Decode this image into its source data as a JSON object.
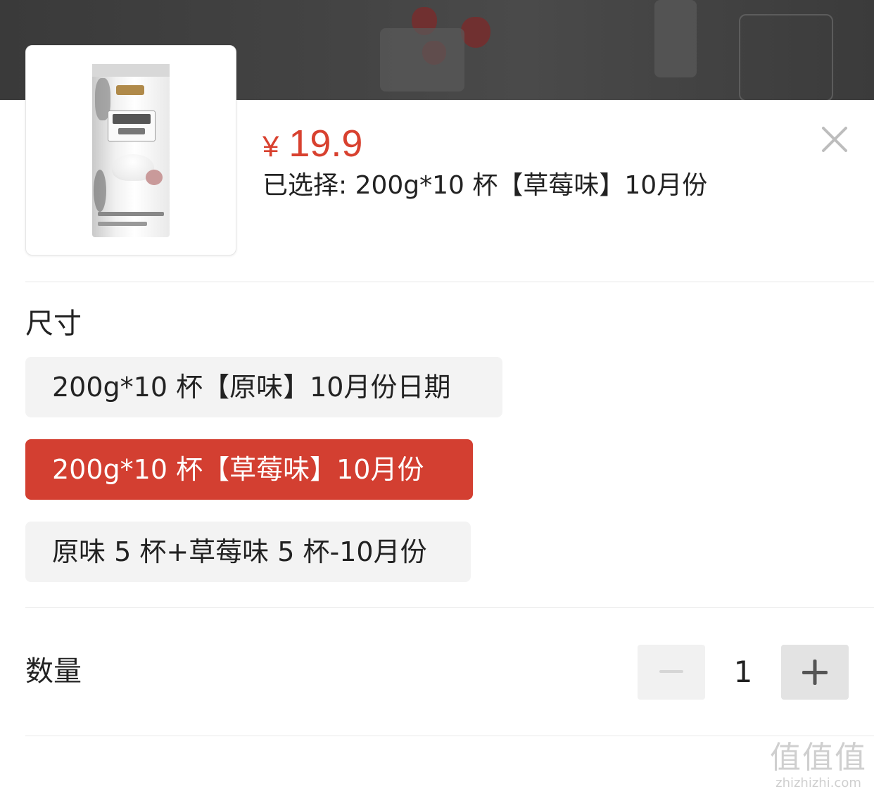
{
  "product": {
    "currency": "¥",
    "price": "19.9",
    "selected_text": "已选择: 200g*10 杯【草莓味】10月份",
    "close_icon": "close-icon",
    "thumbnail_icon": "product-thumbnail"
  },
  "size_section": {
    "title": "尺寸",
    "options": [
      {
        "label": "200g*10 杯【原味】10月份日期",
        "selected": false
      },
      {
        "label": "200g*10 杯【草莓味】10月份",
        "selected": true
      },
      {
        "label": "原味 5 杯+草莓味 5 杯-10月份",
        "selected": false
      }
    ]
  },
  "quantity_section": {
    "title": "数量",
    "value": "1",
    "minus_icon": "minus-icon",
    "plus_icon": "plus-icon"
  },
  "watermark": {
    "logo": "值值值",
    "url": "zhizhizhi.com"
  },
  "colors": {
    "accent": "#d33f31",
    "price": "#d8412f",
    "option_bg": "#f3f3f3"
  }
}
